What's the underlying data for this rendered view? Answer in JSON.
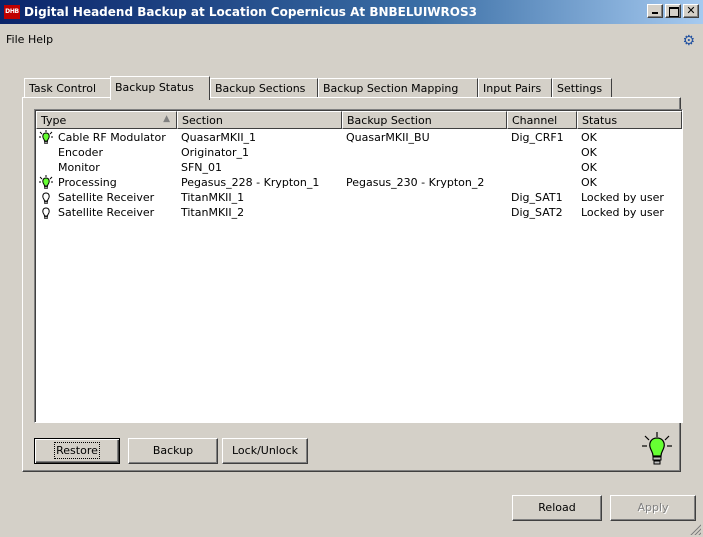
{
  "window": {
    "icon_label": "DHB",
    "title": "Digital Headend Backup at Location Copernicus At BNBELUIWROS3",
    "close_glyph": "✕"
  },
  "menu": [
    "File",
    "Help"
  ],
  "tabs": [
    {
      "label": "Task Control",
      "active": false
    },
    {
      "label": "Backup Status",
      "active": true
    },
    {
      "label": "Backup Sections",
      "active": false
    },
    {
      "label": "Backup Section Mapping",
      "active": false
    },
    {
      "label": "Input Pairs",
      "active": false
    },
    {
      "label": "Settings",
      "active": false
    }
  ],
  "table": {
    "columns": [
      "Type",
      "Section",
      "Backup Section",
      "Channel",
      "Status"
    ],
    "sort_indicator": "▲",
    "rows": [
      {
        "icon": "bulb-green-icon",
        "type": "Cable RF Modulator",
        "section": "QuasarMKII_1",
        "backup_section": "QuasarMKII_BU",
        "channel": "Dig_CRF1",
        "status": "OK"
      },
      {
        "icon": "",
        "type": "Encoder",
        "section": "Originator_1",
        "backup_section": "",
        "channel": "",
        "status": "OK"
      },
      {
        "icon": "",
        "type": "Monitor",
        "section": "SFN_01",
        "backup_section": "",
        "channel": "",
        "status": "OK"
      },
      {
        "icon": "bulb-green-icon",
        "type": "Processing",
        "section": "Pegasus_228 - Krypton_1",
        "backup_section": "Pegasus_230 - Krypton_2",
        "channel": "",
        "status": "OK"
      },
      {
        "icon": "bulb-off-icon",
        "type": "Satellite Receiver",
        "section": "TitanMKII_1",
        "backup_section": "",
        "channel": "Dig_SAT1",
        "status": "Locked by user"
      },
      {
        "icon": "bulb-off-icon",
        "type": "Satellite Receiver",
        "section": "TitanMKII_2",
        "backup_section": "",
        "channel": "Dig_SAT2",
        "status": "Locked by user"
      }
    ]
  },
  "buttons": {
    "restore": "Restore",
    "backup": "Backup",
    "lock_unlock": "Lock/Unlock",
    "reload": "Reload",
    "apply": "Apply"
  },
  "colors": {
    "bulb_green": "#66ff33",
    "title_bar": "#0a246a"
  }
}
